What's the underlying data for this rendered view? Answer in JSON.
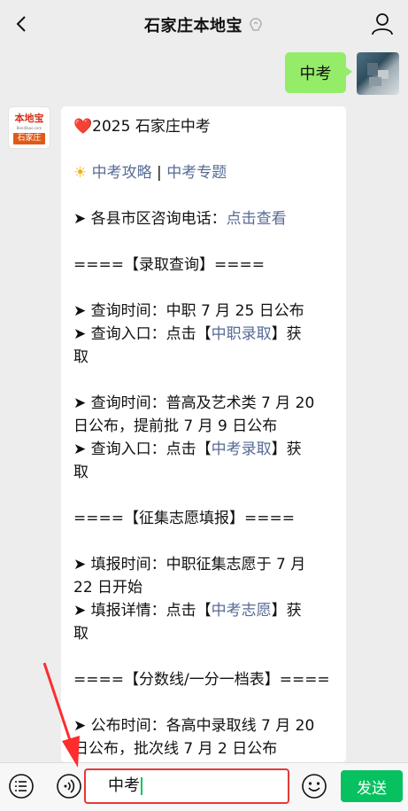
{
  "header": {
    "title": "石家庄本地宝"
  },
  "messages": {
    "outgoing_text": "中考",
    "bot_avatar": {
      "logo_text": "本地宝",
      "url_text": "Bendibao.com",
      "tag_text": "石家庄"
    },
    "incoming": {
      "heart": "❤️",
      "title": "2025 石家庄中考",
      "sun": "☀",
      "link1": "中考攻略",
      "separator": " | ",
      "link2": "中考专题",
      "phone_prefix": "➤ 各县市区咨询电话：",
      "phone_link": "点击查看",
      "section1": "====【录取查询】====",
      "q1_time": "➤ 查询时间：中职 7 月 25 日公布",
      "q1_entry_prefix": "➤ 查询入口：点击【",
      "q1_entry_link": "中职录取",
      "q1_entry_suffix": "】获",
      "q1_entry_tail": "取",
      "q2_time_1": "➤ 查询时间：普高及艺术类 7 月 20",
      "q2_time_2": "日公布，提前批 7 月 9 日公布",
      "q2_entry_prefix": "➤ 查询入口：点击【",
      "q2_entry_link": "中考录取",
      "q2_entry_suffix": "】获",
      "q2_entry_tail": "取",
      "section2": "====【征集志愿填报】====",
      "f_time_1": "➤ 填报时间：中职征集志愿于 7 月",
      "f_time_2": "22 日开始",
      "f_detail_prefix": "➤ 填报详情：点击【",
      "f_detail_link": "中考志愿",
      "f_detail_suffix": "】获",
      "f_detail_tail": "取",
      "section3": "====【分数线/一分一档表】====",
      "s_time_1": "➤ 公布时间：各高中录取线 7 月 20",
      "s_time_2": "日公布，批次线 7 月 2 日公布"
    }
  },
  "input": {
    "value": "中考",
    "send_label": "发送"
  },
  "colors": {
    "bubble_out": "#95ec69",
    "link": "#576b95",
    "send": "#07c160",
    "highlight": "#e53935"
  }
}
